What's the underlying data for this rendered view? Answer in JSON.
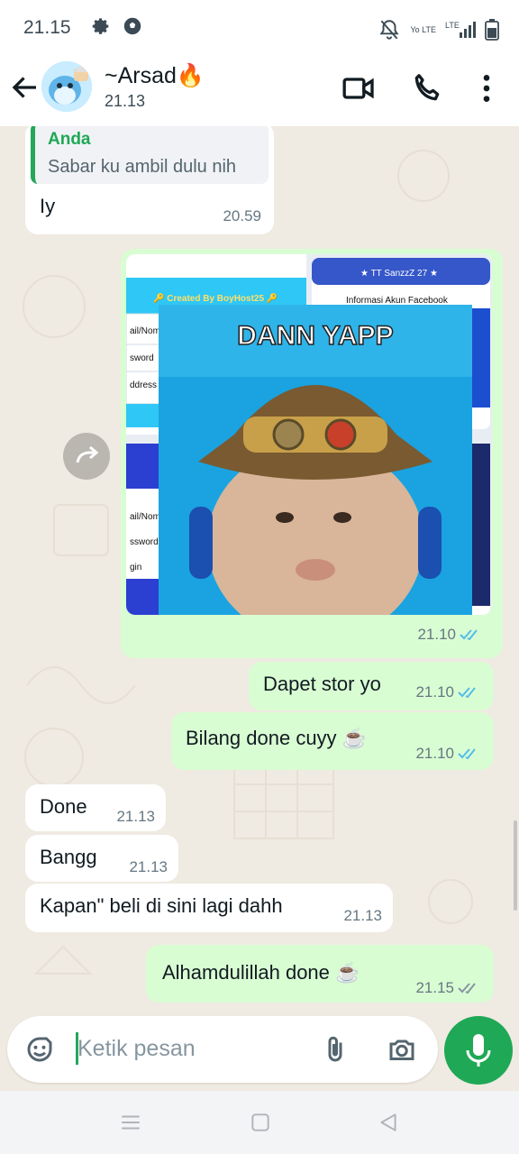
{
  "status_bar": {
    "time": "21.15",
    "network_small": "Yo LTE",
    "network_lte": "LTE"
  },
  "header": {
    "contact_name": "~Arsad",
    "fire_emoji": "🔥",
    "last_seen": "21.13"
  },
  "messages": [
    {
      "id": "m1",
      "direction": "in",
      "quote_author": "Anda",
      "quote_text": "Sabar ku ambil dulu nih",
      "text": "Iy",
      "time": "20.59"
    },
    {
      "id": "m2",
      "direction": "out",
      "type": "image",
      "image_text_top": "★ TT SanzzZ 27 ★",
      "image_text_created": "🔑 Created By BoyHost25 🔑",
      "image_text_info": "Informasi Akun Facebook",
      "image_text_fields": [
        "ail/Nom",
        "sword",
        "ddress"
      ],
      "image_text_fields2": [
        "ail/Nom",
        "ssword",
        "gin"
      ],
      "sticker_text": "DANN YAPP",
      "time": "21.10",
      "status": "read"
    },
    {
      "id": "m3",
      "direction": "out",
      "text": "Dapet stor yo",
      "time": "21.10",
      "status": "read"
    },
    {
      "id": "m4",
      "direction": "out",
      "text": "Bilang done cuyy ☕",
      "time": "21.10",
      "status": "read"
    },
    {
      "id": "m5",
      "direction": "in",
      "text": "Done",
      "time": "21.13"
    },
    {
      "id": "m6",
      "direction": "in",
      "text": "Bangg",
      "time": "21.13"
    },
    {
      "id": "m7",
      "direction": "in",
      "text": "Kapan\" beli di sini lagi dahh",
      "time": "21.13"
    },
    {
      "id": "m8",
      "direction": "out",
      "text": "Alhamdulillah done ☕",
      "time": "21.15",
      "status": "delivered"
    }
  ],
  "composer": {
    "placeholder": "Ketik pesan"
  },
  "colors": {
    "outgoing_bubble": "#d9fdd3",
    "incoming_bubble": "#ffffff",
    "accent_green": "#1fa855",
    "read_tick_blue": "#53bdeb",
    "wallpaper": "#efeae2"
  },
  "icons": [
    "gear-icon",
    "soccer-ball-icon",
    "mute-bell-icon",
    "signal-icon",
    "battery-icon",
    "back-arrow-icon",
    "video-call-icon",
    "phone-icon",
    "more-vert-icon",
    "forward-icon",
    "emoji-sticker-icon",
    "attach-icon",
    "camera-icon",
    "mic-icon",
    "menu-nav-icon",
    "home-nav-icon",
    "back-nav-icon"
  ]
}
